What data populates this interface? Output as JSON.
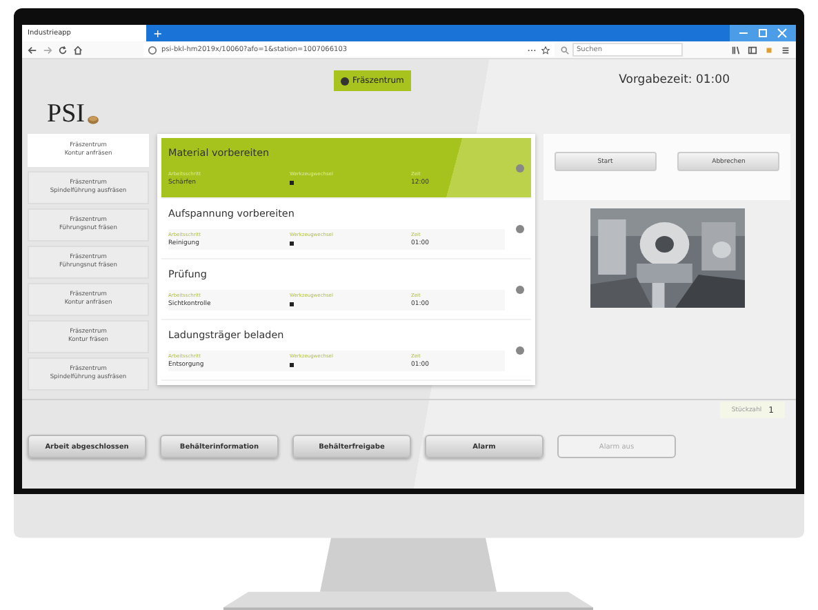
{
  "browser": {
    "tab_title": "Industrieapp",
    "new_tab": "+",
    "url": "psi-bkl-hm2019x/10060?afo=1&station=1007066103",
    "search": {
      "placeholder": "Suchen"
    }
  },
  "header": {
    "logo": "PSI",
    "station": "Fräszentrum",
    "time": "Vorgabezeit: 01:00"
  },
  "sidebar": {
    "items": [
      {
        "line1": "Fräszentrum",
        "line2": "Kontur anfräsen",
        "selected": true
      },
      {
        "line1": "Fräszentrum",
        "line2": "Spindelführung ausfräsen",
        "selected": false
      },
      {
        "line1": "Fräszentrum",
        "line2": "Führungsnut fräsen",
        "selected": false
      },
      {
        "line1": "Fräszentrum",
        "line2": "Führungsnut fräsen",
        "selected": false
      },
      {
        "line1": "Fräszentrum",
        "line2": "Kontur anfräsen",
        "selected": false
      },
      {
        "line1": "Fräszentrum",
        "line2": "Kontur fräsen",
        "selected": false
      },
      {
        "line1": "Fräszentrum",
        "line2": "Spindelführung ausfräsen",
        "selected": false
      }
    ]
  },
  "steps": [
    {
      "title": "Material vorbereiten",
      "label_1": "Arbeitsschritt",
      "value_1": "Schärfen",
      "label_2": "Werkzeugwechsel",
      "label_3": "Zeit",
      "value_3": "12:00",
      "selected": true
    },
    {
      "title": "Aufspannung vorbereiten",
      "label_1": "Arbeitsschritt",
      "value_1": "Reinigung",
      "label_2": "Werkzeugwechsel",
      "label_3": "Zeit",
      "value_3": "01:00",
      "selected": false
    },
    {
      "title": "Prüfung",
      "label_1": "Arbeitsschritt",
      "value_1": "Sichtkontrolle",
      "label_2": "Werkzeugwechsel",
      "label_3": "Zeit",
      "value_3": "01:00",
      "selected": false
    },
    {
      "title": "Ladungsträger beladen",
      "label_1": "Arbeitsschritt",
      "value_1": "Entsorgung",
      "label_2": "Werkzeugwechsel",
      "label_3": "Zeit",
      "value_3": "01:00",
      "selected": false
    }
  ],
  "actions": [
    "Start",
    "Abbrechen"
  ],
  "counter": {
    "label": "Stückzahl",
    "value": "1"
  },
  "footer_buttons": [
    {
      "label": "Arbeit abgeschlossen",
      "disabled": false
    },
    {
      "label": "Behälterinformation",
      "disabled": false
    },
    {
      "label": "Behälterfreigabe",
      "disabled": false
    },
    {
      "label": "Alarm",
      "disabled": false
    },
    {
      "label": "Alarm aus",
      "disabled": true
    }
  ]
}
